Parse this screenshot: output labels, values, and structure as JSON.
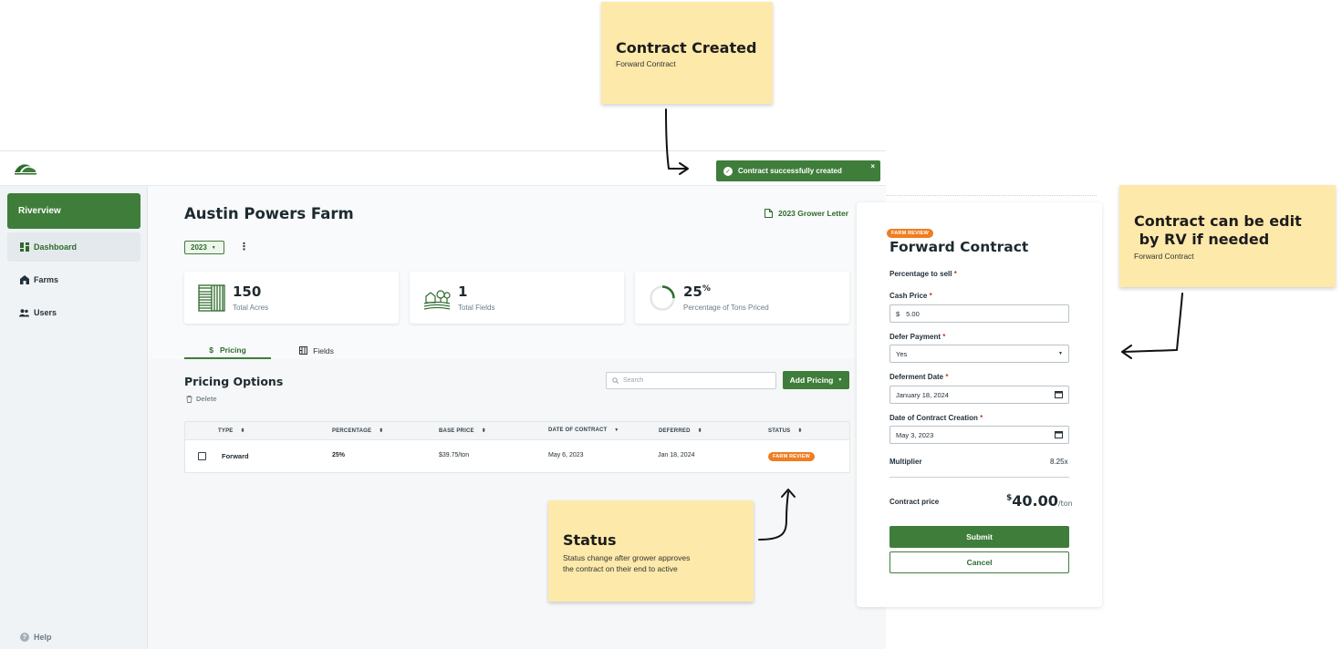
{
  "notes": {
    "created": {
      "title": "Contract Created",
      "sub": "Forward Contract"
    },
    "edit": {
      "title_line1": "Contract can be edit",
      "title_line2": " by RV if needed",
      "sub": "Forward Contract"
    },
    "status": {
      "title": "Status",
      "body": "Status change after grower approves the contract on their end to active"
    }
  },
  "toast": {
    "message": "Contract successfully created",
    "close": "×"
  },
  "sidebar": {
    "brand": "Riverview",
    "items": [
      {
        "label": "Dashboard",
        "icon": "dashboard-icon"
      },
      {
        "label": "Farms",
        "icon": "barn-icon"
      },
      {
        "label": "Users",
        "icon": "users-icon"
      }
    ],
    "help": "Help"
  },
  "header": {
    "farm_name": "Austin Powers Farm",
    "grower_letter": "2023 Grower Letter",
    "year": "2023",
    "kebab": "⋮"
  },
  "stats": [
    {
      "value": "150",
      "suffix": "",
      "label": "Total Acres",
      "icon": "field-grid-icon"
    },
    {
      "value": "1",
      "suffix": "",
      "label": "Total Fields",
      "icon": "farm-landscape-icon"
    },
    {
      "value": "25",
      "suffix": "%",
      "label": "Percentage of Tons Priced",
      "icon": "progress-ring-icon",
      "progress": 0.25
    }
  ],
  "tabs": [
    {
      "label": "Pricing",
      "icon": "$"
    },
    {
      "label": "Fields",
      "icon": "fields-icon"
    }
  ],
  "pricing": {
    "title": "Pricing Options",
    "delete": "Delete",
    "search_placeholder": "Search",
    "add_button": "Add Pricing",
    "columns": [
      "TYPE",
      "PERCENTAGE",
      "BASE PRICE",
      "DATE OF CONTRACT",
      "DEFERRED",
      "STATUS"
    ],
    "rows": [
      {
        "type": "Forward",
        "percentage": "25%",
        "base_price": "$39.75/ton",
        "date": "May 6, 2023",
        "deferred": "Jan 18, 2024",
        "status": "FARM REVIEW"
      }
    ]
  },
  "panel": {
    "badge": "FARM REVIEW",
    "title": "Forward Contract",
    "percentage_label": "Percentage to sell",
    "cash_price_label": "Cash Price",
    "cash_price_prefix": "$",
    "cash_price_value": "5.00",
    "defer_label": "Defer Payment",
    "defer_value": "Yes",
    "deferment_label": "Deferment Date",
    "deferment_value": "January 18, 2024",
    "creation_label": "Date of Contract Creation",
    "creation_value": "May 3, 2023",
    "multiplier_label": "Multiplier",
    "multiplier_value": "8.25x",
    "contract_price_label": "Contract price",
    "contract_price_currency": "$",
    "contract_price_value": "40.00",
    "contract_price_unit": "/ton",
    "required_mark": "*",
    "submit": "Submit",
    "cancel": "Cancel"
  },
  "colors": {
    "primary": "#3f7d3a",
    "badge": "#ef7d21",
    "note": "#fde9aa"
  }
}
